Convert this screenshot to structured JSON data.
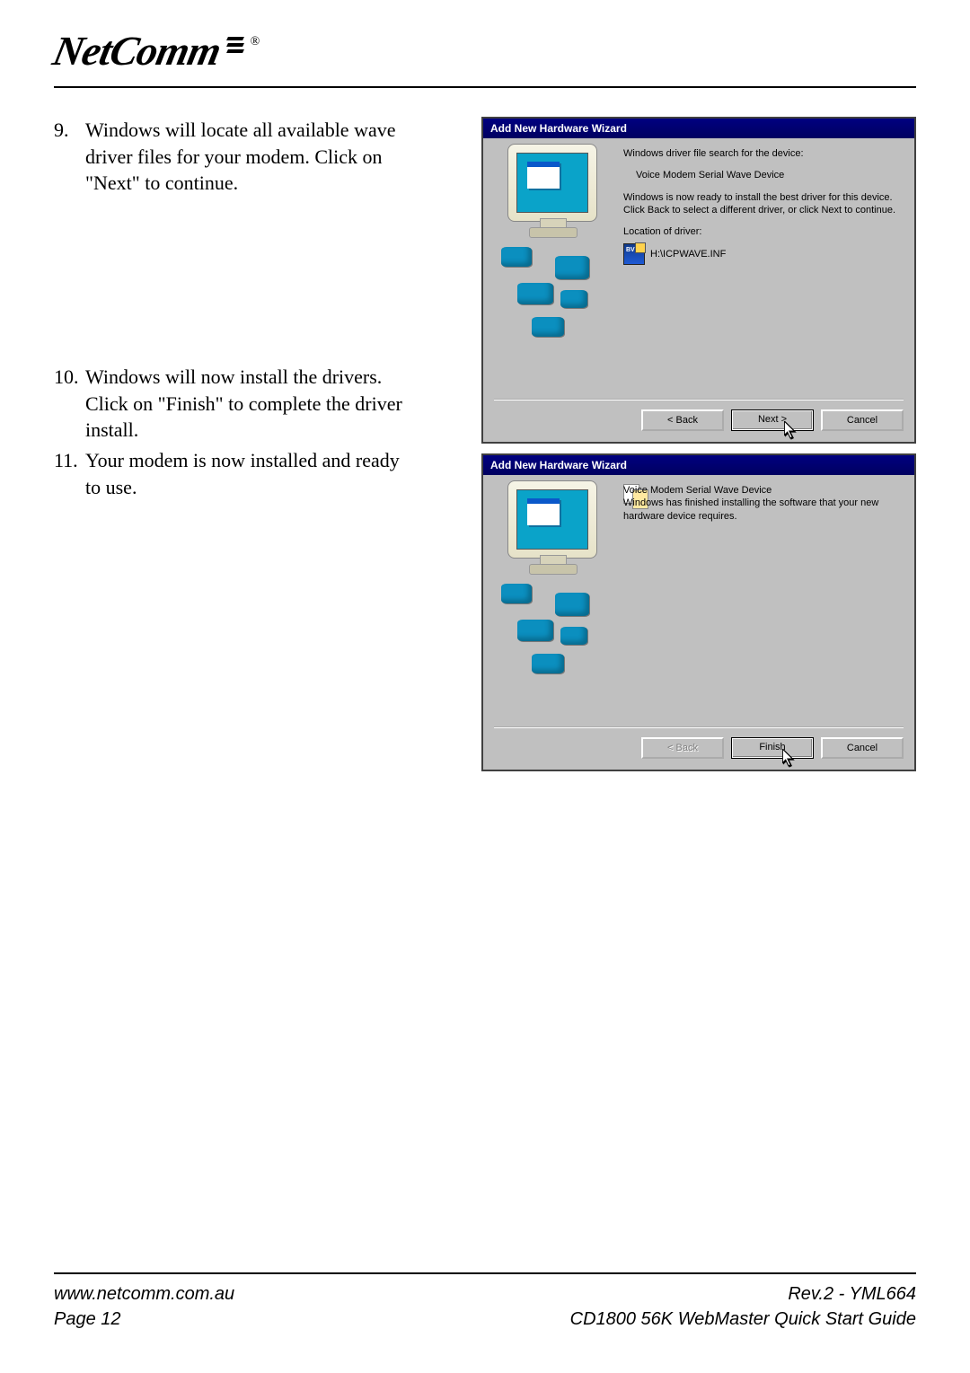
{
  "brand": {
    "name": "NetComm",
    "registered": "®"
  },
  "instructions": {
    "i9": {
      "num": "9.",
      "text": "Windows will locate all available wave driver files for your modem.  Click on \"Next\" to continue."
    },
    "i10": {
      "num": "10.",
      "text": "Windows will now install the drivers.  Click on \"Finish\" to complete the driver install."
    },
    "i11": {
      "num": "11.",
      "text": "Your modem is now installed and ready to use."
    }
  },
  "dialog1": {
    "title": "Add New Hardware Wizard",
    "line1": "Windows driver file search for the device:",
    "device": "Voice Modem Serial Wave Device",
    "line2": "Windows is now ready to install the best driver for this device. Click Back to select a different driver, or click Next to continue.",
    "location_label": "Location of driver:",
    "file_name": "H:\\ICPWAVE.INF",
    "file_icon_text": "BVRP",
    "buttons": {
      "back": "< Back",
      "next": "Next >",
      "cancel": "Cancel"
    }
  },
  "dialog2": {
    "title": "Add New Hardware Wizard",
    "device": "Voice Modem Serial Wave Device",
    "line1": "Windows has finished installing the software that your new hardware device requires.",
    "buttons": {
      "back": "< Back",
      "finish": "Finish",
      "cancel": "Cancel"
    }
  },
  "footer": {
    "url": "www.netcomm.com.au",
    "rev": "Rev.2 - YML664",
    "page": "Page 12",
    "title": "CD1800 56K WebMaster Quick Start Guide"
  }
}
